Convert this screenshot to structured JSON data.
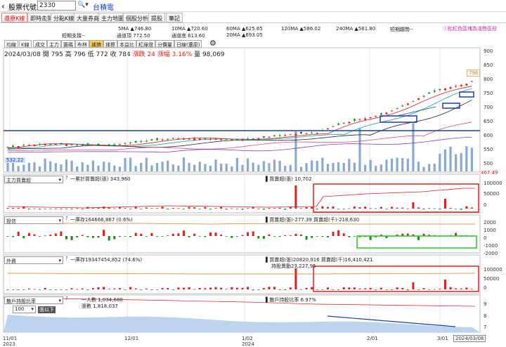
{
  "topbar": {
    "label": "股票代號",
    "code": "2330",
    "search_icon": "search-icon",
    "name": "台積電"
  },
  "tabs": [
    {
      "label": "還原K線",
      "active": true
    },
    {
      "label": "即時走勢"
    },
    {
      "label": "分點K線"
    },
    {
      "label": "大量券商"
    },
    {
      "label": "主力地圖"
    },
    {
      "label": "個股分析"
    },
    {
      "label": "提股"
    },
    {
      "label": "筆記"
    }
  ],
  "tip": "ⓘ松紅色區塊為漲勢區段",
  "ma_legend": [
    {
      "text": "5MA ▲746.80",
      "color": "#e0201e"
    },
    {
      "text": "10MA ▲720.60",
      "color": "#1aa6a6"
    },
    {
      "text": "60MA ▲625.65",
      "color": "#1a3fa8"
    },
    {
      "text": "120MA ▲586.02",
      "color": "#d94a8c"
    },
    {
      "text": "240MA ▲561.80",
      "color": "#8a3ac0"
    },
    {
      "text": "短期趨勢--",
      "color": "#2a9c2a"
    },
    {
      "text": "短期支撐--",
      "color": "#e0201e"
    },
    {
      "text": "通道頂 772.50",
      "color": "#333"
    },
    {
      "text": "通道底 613.60",
      "color": "#333"
    },
    {
      "text": "20MA ▲693.05",
      "color": "#e0201e"
    }
  ],
  "toolbar": {
    "buttons": [
      "均線",
      "K線",
      "成交",
      "主力",
      "籌碼",
      "布林",
      "揉擠",
      "揉擦",
      "本益比",
      "紅綠燈",
      "分價量",
      "日線(還原)"
    ],
    "active_index": 6,
    "gear_icon": "gear-icon"
  },
  "info": {
    "date": "2024/03/08",
    "open_label": "開",
    "open": "795",
    "high_label": "高",
    "high": "796",
    "low_label": "低",
    "low": "772",
    "close_label": "收",
    "close": "784",
    "change_label": "漲跌",
    "change": "24",
    "pct_label": "漲幅",
    "pct": "3.16%",
    "vol_label": "量",
    "vol": "98,069"
  },
  "price_chart": {
    "y_ticks": [
      "900",
      "850",
      "800",
      "750",
      "700",
      "650",
      "600",
      "550",
      "500"
    ],
    "last_price": "796",
    "low_marker": "532.22",
    "right_label": "467.49"
  },
  "panels": [
    {
      "selector": "主力買賣超",
      "left_text": "一累計買賣超(張) 343,960",
      "right_text": "▌買賣超(張) 10,702",
      "y_ticks": [
        "100000",
        "50000",
        "0"
      ]
    },
    {
      "selector": "投信",
      "left_text": "一庫存164666,867 (0.6%)",
      "right_text": "▌買賣超(張)-277.39 買賣超(千)-218,630",
      "y_ticks": [
        "2000",
        "1000",
        "0",
        "-1000",
        "-2000"
      ]
    },
    {
      "selector": "外資",
      "left_text": "一庫存19347454,852 (74.6%)",
      "right_text": "▌買賣超(張)20820,916 買賣超(千)16,410,421",
      "right_text2": "持股異動23,227,95",
      "y_ticks": [
        "100000",
        "50000",
        "0"
      ]
    },
    {
      "selector": "散戶持股比率",
      "left_text": "一人數 1,034,680",
      "left_text2": "張數 1,818,037",
      "right_text": "▌散戶持股比率 6.97%",
      "y_ticks": [
        "9",
        "8",
        "7"
      ],
      "filter_value": "100",
      "filter_label": "張以下"
    }
  ],
  "x_axis": [
    {
      "label": "11/01",
      "sub": "2023"
    },
    {
      "label": "12/01",
      "sub": ""
    },
    {
      "label": "1/02",
      "sub": "2024"
    },
    {
      "label": "2/01",
      "sub": ""
    },
    {
      "label": "3/01",
      "sub": ""
    }
  ],
  "current_date": "2024/03/08",
  "help_icon": "help-icon",
  "colors": {
    "up": "#e0201e",
    "down": "#1a8a1a",
    "volume": "#8aa9cf",
    "channel": "#1a3fa8",
    "highlight_red": "#e0201e",
    "highlight_green": "#22cc22"
  }
}
